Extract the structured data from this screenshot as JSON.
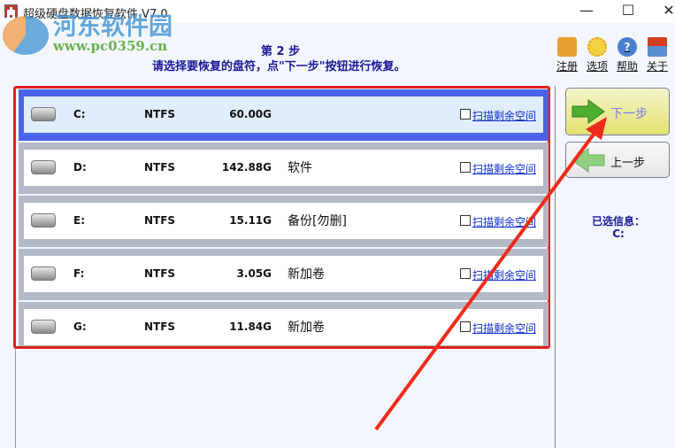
{
  "window": {
    "title": "超级硬盘数据恢复软件 V7.0",
    "minimize": "—",
    "maximize": "☐",
    "close": "✕"
  },
  "watermark": {
    "name": "河东软件园",
    "url": "www.pc0359.cn"
  },
  "header": {
    "step": "第 2 步",
    "instruction": "请选择要恢复的盘符，点\"下一步\"按钮进行恢复。"
  },
  "toolbar": [
    {
      "label": "注册",
      "icon": "cart-check-icon"
    },
    {
      "label": "选项",
      "icon": "gear-icon"
    },
    {
      "label": "帮助",
      "icon": "help-icon"
    },
    {
      "label": "关于",
      "icon": "home-icon"
    }
  ],
  "drives": [
    {
      "letter": "C:",
      "fs": "NTFS",
      "size": "60.00G",
      "name": "",
      "scan": "扫描剩余空间",
      "selected": true
    },
    {
      "letter": "D:",
      "fs": "NTFS",
      "size": "142.88G",
      "name": "软件",
      "scan": "扫描剩余空间",
      "selected": false
    },
    {
      "letter": "E:",
      "fs": "NTFS",
      "size": "15.11G",
      "name": "备份[勿删]",
      "scan": "扫描剩余空间",
      "selected": false
    },
    {
      "letter": "F:",
      "fs": "NTFS",
      "size": "3.05G",
      "name": "新加卷",
      "scan": "扫描剩余空间",
      "selected": false
    },
    {
      "letter": "G:",
      "fs": "NTFS",
      "size": "11.84G",
      "name": "新加卷",
      "scan": "扫描剩余空间",
      "selected": false
    }
  ],
  "buttons": {
    "next": "下一步",
    "prev": "上一步"
  },
  "selected_info": {
    "label": "已选信息：",
    "value": "C:"
  }
}
